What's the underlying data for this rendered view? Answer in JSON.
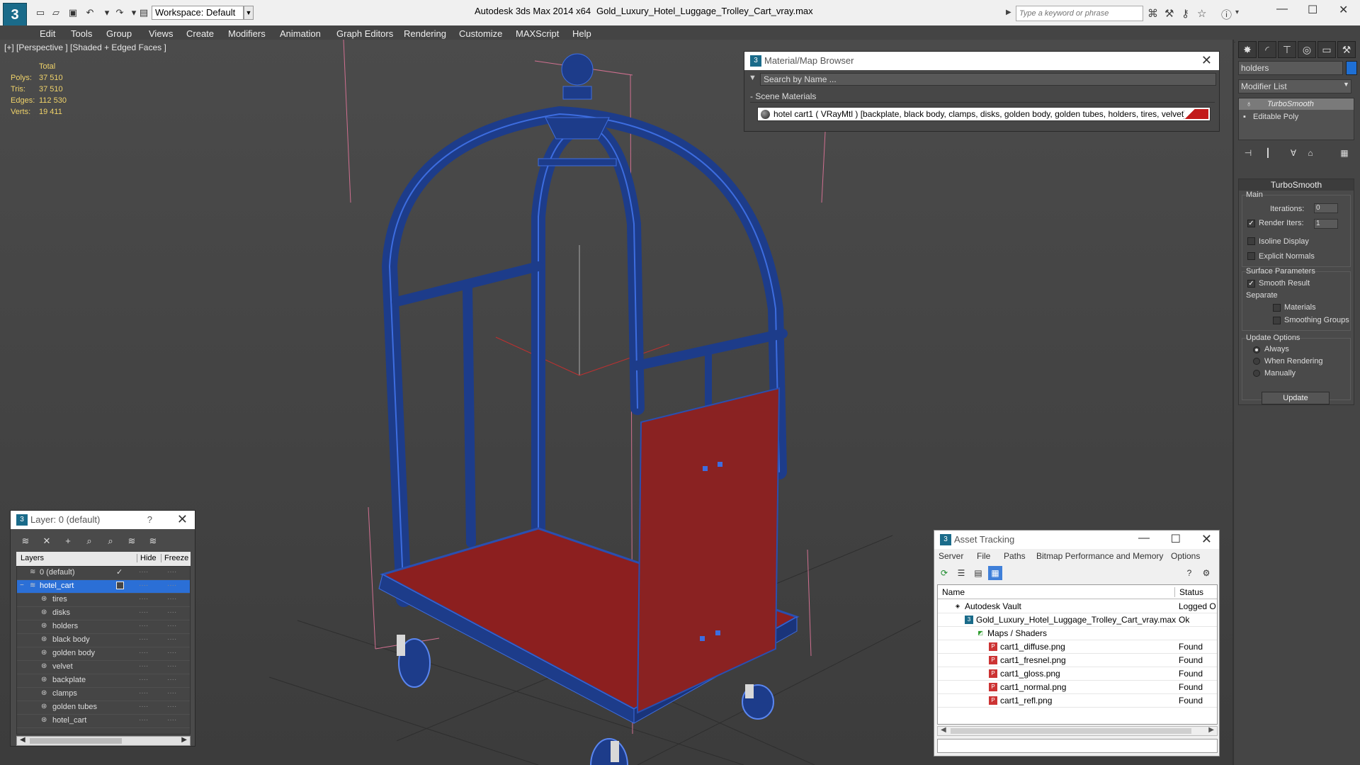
{
  "titlebar": {
    "logo": "3",
    "workspace": "Workspace: Default",
    "app": "Autodesk 3ds Max  2014 x64",
    "file": "Gold_Luxury_Hotel_Luggage_Trolley_Cart_vray.max",
    "search_placeholder": "Type a keyword or phrase"
  },
  "menu": [
    "Edit",
    "Tools",
    "Group",
    "Views",
    "Create",
    "Modifiers",
    "Animation",
    "Graph Editors",
    "Rendering",
    "Customize",
    "MAXScript",
    "Help"
  ],
  "viewport": {
    "label": "[+] [Perspective ] [Shaded + Edged Faces ]",
    "stats_total": "Total",
    "stats": [
      {
        "label": "Polys:",
        "value": "37 510"
      },
      {
        "label": "Tris:",
        "value": "37 510"
      },
      {
        "label": "Edges:",
        "value": "112 530"
      },
      {
        "label": "Verts:",
        "value": "19 411"
      }
    ]
  },
  "material_browser": {
    "title": "Material/Map Browser",
    "search": "Search by Name ...",
    "section": "Scene Materials",
    "material": "hotel cart1  ( VRayMtl ) [backplate, black body, clamps, disks, golden body, golden tubes, holders, tires, velvet]"
  },
  "command_panel": {
    "object_name": "holders",
    "object_color": "#1e6fd4",
    "modifier_list": "Modifier List",
    "stack": [
      "TurboSmooth",
      "Editable Poly"
    ],
    "rollout": "TurboSmooth",
    "main": "Main",
    "iterations_label": "Iterations:",
    "iterations": "0",
    "render_iters_label": "Render Iters:",
    "render_iters": "1",
    "isoline": "Isoline Display",
    "explicit_normals": "Explicit Normals",
    "surface_params": "Surface Parameters",
    "smooth_result": "Smooth Result",
    "separate": "Separate",
    "materials": "Materials",
    "smoothing_groups": "Smoothing Groups",
    "update_options": "Update Options",
    "always": "Always",
    "when_rendering": "When Rendering",
    "manually": "Manually",
    "update": "Update"
  },
  "layers": {
    "title": "Layer: 0 (default)",
    "help": "?",
    "col_layers": "Layers",
    "col_hide": "Hide",
    "col_freeze": "Freeze",
    "rows": [
      "0 (default)",
      "hotel_cart",
      "tires",
      "disks",
      "holders",
      "black body",
      "golden body",
      "velvet",
      "backplate",
      "clamps",
      "golden tubes",
      "hotel_cart"
    ]
  },
  "asset_tracking": {
    "title": "Asset Tracking",
    "menu": [
      "Server",
      "File",
      "Paths",
      "Bitmap Performance and Memory",
      "Options"
    ],
    "col_name": "Name",
    "col_status": "Status",
    "rows": [
      {
        "name": "Autodesk Vault",
        "status": "Logged O"
      },
      {
        "name": "Gold_Luxury_Hotel_Luggage_Trolley_Cart_vray.max",
        "status": "Ok"
      },
      {
        "name": "Maps / Shaders",
        "status": ""
      },
      {
        "name": "cart1_diffuse.png",
        "status": "Found"
      },
      {
        "name": "cart1_fresnel.png",
        "status": "Found"
      },
      {
        "name": "cart1_gloss.png",
        "status": "Found"
      },
      {
        "name": "cart1_normal.png",
        "status": "Found"
      },
      {
        "name": "cart1_refl.png",
        "status": "Found"
      }
    ]
  }
}
